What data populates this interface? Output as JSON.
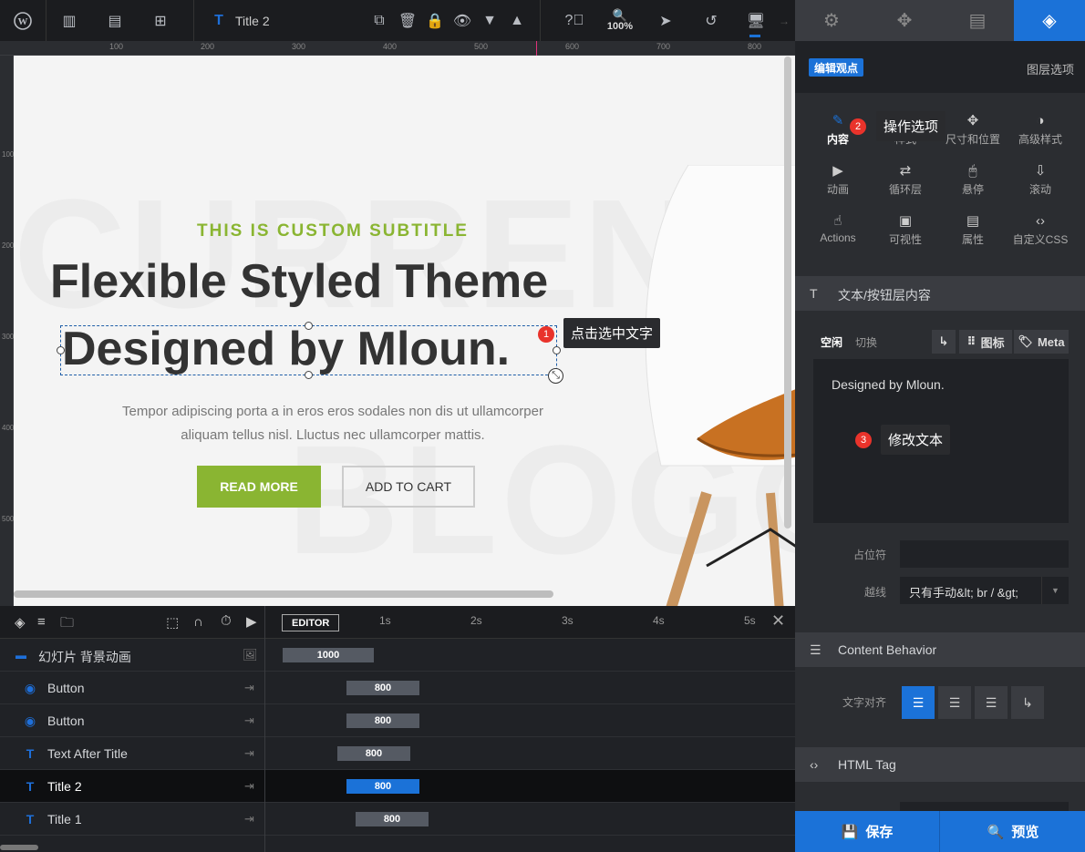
{
  "toolbar": {
    "layer_title": "Title 2",
    "zoom": "100%"
  },
  "ruler": {
    "h_labels": [
      "100",
      "200",
      "300",
      "400",
      "500",
      "600",
      "700",
      "800"
    ],
    "v_labels": [
      "100",
      "200",
      "300",
      "400",
      "500"
    ]
  },
  "slide": {
    "bg_word_1": "CURRENC",
    "bg_word_2": "BLOGG",
    "subtitle": "THIS IS CUSTOM SUBTITLE",
    "title_1": "Flexible Styled Theme",
    "title_2": "Designed by Mloun.",
    "description_line_1": "Tempor adipiscing porta a in eros eros sodales non dis ut ullamcorper",
    "description_line_2": "aliquam tellus nisl. Lluctus nec ullamcorper mattis.",
    "read_more": "READ MORE",
    "add_to_cart": "ADD TO CART"
  },
  "hints": {
    "hint_1_num": "1",
    "hint_1": "点击选中文字",
    "hint_2_num": "2",
    "hint_2": "操作选项",
    "hint_3_num": "3",
    "hint_3": "修改文本"
  },
  "timeline": {
    "editor_label": "EDITOR",
    "time_marks": [
      "1s",
      "2s",
      "3s",
      "4s",
      "5s"
    ],
    "rows": [
      {
        "name": "幻灯片 背景动画",
        "bar": "1000"
      },
      {
        "name": "Button",
        "bar": "800"
      },
      {
        "name": "Button",
        "bar": "800"
      },
      {
        "name": "Text After Title",
        "bar": "800"
      },
      {
        "name": "Title 2",
        "bar": "800"
      },
      {
        "name": "Title 1",
        "bar": "800"
      }
    ]
  },
  "sidebar": {
    "edit_view": "编辑观点",
    "layer_options": "图层选项",
    "options": [
      {
        "label": "内容"
      },
      {
        "label": "样式"
      },
      {
        "label": "尺寸和位置"
      },
      {
        "label": "高级样式"
      },
      {
        "label": "动画"
      },
      {
        "label": "循环层"
      },
      {
        "label": "悬停"
      },
      {
        "label": "滚动"
      },
      {
        "label": "Actions"
      },
      {
        "label": "可视性"
      },
      {
        "label": "属性"
      },
      {
        "label": "自定义CSS"
      }
    ],
    "section_text": "文本/按钮层内容",
    "tab_idle": "空闲",
    "tab_toggle": "切换",
    "btn_icon": "图标",
    "btn_meta": "Meta",
    "text_value": "Designed by Mloun.",
    "placeholder_label": "占位符",
    "placeholder_value": "",
    "wrap_label": "越线",
    "wrap_value": "只有手动&lt; br / &gt;",
    "section_behavior": "Content Behavior",
    "align_label": "文字对齐",
    "section_html": "HTML Tag",
    "save": "保存",
    "preview": "预览"
  },
  "colors": {
    "accent": "#1b72d8",
    "green": "#8ab532",
    "badge_red": "#e9332b"
  }
}
